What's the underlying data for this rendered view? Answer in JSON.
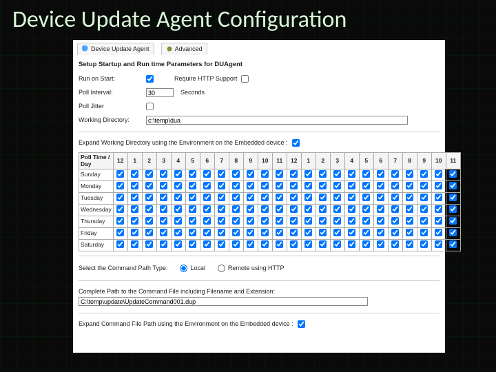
{
  "slideTitle": "Device Update Agent Configuration",
  "tabs": [
    {
      "label": "Device Update Agent",
      "icon": "globe-icon"
    },
    {
      "label": "Advanced",
      "icon": "gear-icon"
    }
  ],
  "sectionTitle": "Setup Startup and Run time Parameters for DUAgent",
  "fields": {
    "runOnStart": {
      "label": "Run on Start:",
      "checked": true
    },
    "requireHttp": {
      "label": "Require HTTP Support",
      "checked": false
    },
    "pollInterval": {
      "label": "Poll Interval:",
      "value": "30",
      "unit": "Seconds"
    },
    "pollJitter": {
      "label": "Poll Jitter",
      "checked": false
    },
    "workingDir": {
      "label": "Working Directory:",
      "value": "c:\\temp\\dua"
    },
    "expandWorking": {
      "label": "Expand Working Directory using the Environment on the Embedded device :",
      "checked": true
    }
  },
  "schedule": {
    "header": "Poll Time / Day",
    "hours": [
      "12",
      "1",
      "2",
      "3",
      "4",
      "5",
      "6",
      "7",
      "8",
      "9",
      "10",
      "11",
      "12",
      "1",
      "2",
      "3",
      "4",
      "5",
      "6",
      "7",
      "8",
      "9",
      "10",
      "11"
    ],
    "days": [
      "Sunday",
      "Monday",
      "Tuesday",
      "Wednesday",
      "Thursday",
      "Friday",
      "Saturday"
    ]
  },
  "commandPath": {
    "label": "Select the Command Path Type:",
    "options": [
      {
        "label": "Local",
        "checked": true
      },
      {
        "label": "Remote using HTTP",
        "checked": false
      }
    ],
    "completePathLabel": "Complete Path to the Command File including Filename and Extension:",
    "completePathValue": "C:\\temp\\update\\UpdateCommand001.dup",
    "expandCmd": {
      "label": "Expand Command File Path using the Environment on the Embedded device :",
      "checked": true
    }
  }
}
